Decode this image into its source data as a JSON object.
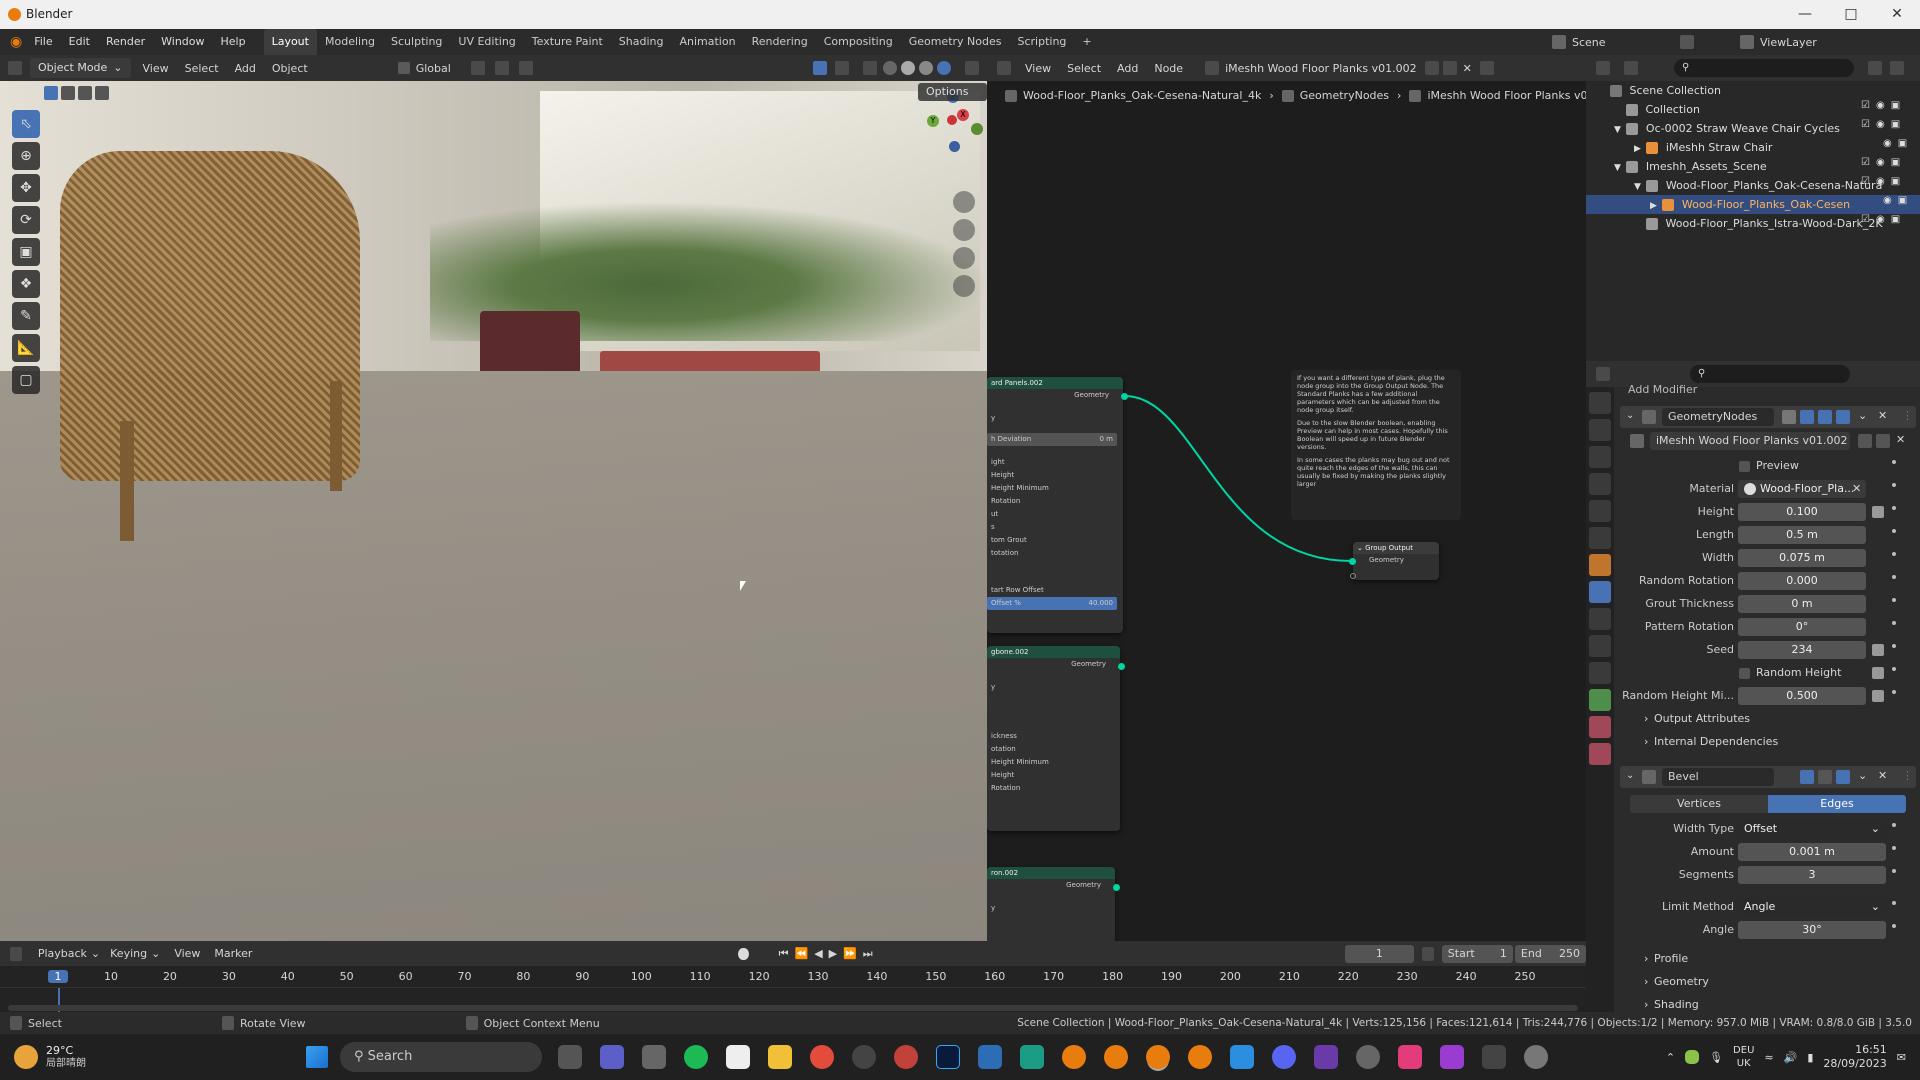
{
  "window": {
    "title": "Blender"
  },
  "menus": [
    "File",
    "Edit",
    "Render",
    "Window",
    "Help"
  ],
  "workspaces": [
    {
      "label": "Layout",
      "active": true
    },
    {
      "label": "Modeling"
    },
    {
      "label": "Sculpting"
    },
    {
      "label": "UV Editing"
    },
    {
      "label": "Texture Paint"
    },
    {
      "label": "Shading"
    },
    {
      "label": "Animation"
    },
    {
      "label": "Rendering"
    },
    {
      "label": "Compositing"
    },
    {
      "label": "Geometry Nodes"
    },
    {
      "label": "Scripting"
    }
  ],
  "scene": {
    "label": "Scene",
    "view_layer": "ViewLayer"
  },
  "viewport": {
    "mode": "Object Mode",
    "menus": [
      "View",
      "Select",
      "Add",
      "Object"
    ],
    "transform": "Global",
    "options": "Options",
    "gizmo": {
      "x": "X",
      "y": "Y",
      "z": "Z"
    }
  },
  "node_editor": {
    "menus": [
      "View",
      "Select",
      "Add",
      "Node"
    ],
    "tree_name": "iMeshh Wood Floor Planks v01.002",
    "breadcrumb": [
      "Wood-Floor_Planks_Oak-Cesena-Natural_4k",
      "GeometryNodes",
      "iMeshh Wood Floor Planks v01.002"
    ],
    "note": {
      "p1": "If you want a different type of plank, plug the node group into the Group Output Node. The Standard Planks has a few additional parameters which can be adjusted from the node group itself.",
      "p2": "Due to the slow Blender boolean, enabling Preview can help in most cases. Hopefully this Boolean will speed up in future Blender versions.",
      "p3": "In some cases the planks may bug out and not quite reach the edges of the walls, this can usually be fixed by making the planks slightly larger"
    },
    "nodes": [
      {
        "title": "ard Panels.002",
        "output": "Geometry",
        "rows": [
          "y",
          "h Deviation",
          "ight",
          "Height",
          "Height Minimum",
          "Rotation",
          "ut",
          "s",
          "tom Grout",
          "totation",
          "tart Row Offset",
          "Offset %"
        ],
        "dev_val": "0 m",
        "offset_val": "40.000"
      },
      {
        "title": "gbone.002",
        "output": "Geometry",
        "rows": [
          "y",
          "ickness",
          "otation",
          "Height Minimum",
          "Height",
          "Rotation"
        ]
      },
      {
        "title": "ron.002",
        "output": "Geometry",
        "rows": [
          "y"
        ]
      }
    ],
    "group_output": {
      "title": "Group Output",
      "input": "Geometry"
    }
  },
  "outliner": {
    "rows": [
      {
        "label": "Scene Collection",
        "indent": 0
      },
      {
        "label": "Collection",
        "indent": 1
      },
      {
        "label": "Oc-0002 Straw Weave Chair Cycles",
        "indent": 1
      },
      {
        "label": "iMeshh Straw Chair",
        "indent": 2
      },
      {
        "label": "Imeshh_Assets_Scene",
        "indent": 1
      },
      {
        "label": "Wood-Floor_Planks_Oak-Cesena-Natura",
        "indent": 2
      },
      {
        "label": "Wood-Floor_Planks_Oak-Cesen",
        "indent": 3,
        "selected": true
      },
      {
        "label": "Wood-Floor_Planks_Istra-Wood-Dark_2K",
        "indent": 2
      }
    ]
  },
  "properties": {
    "add_modifier": "Add Modifier",
    "gn_modifier": {
      "name": "GeometryNodes",
      "tree": "iMeshh Wood Floor Planks v01.002"
    },
    "fields": [
      {
        "label": "Preview",
        "type": "check"
      },
      {
        "label": "Material",
        "value": "Wood-Floor_Pla...",
        "type": "material"
      },
      {
        "label": "Height",
        "value": "0.100"
      },
      {
        "label": "Length",
        "value": "0.5 m"
      },
      {
        "label": "Width",
        "value": "0.075 m"
      },
      {
        "label": "Random Rotation",
        "value": "0.000"
      },
      {
        "label": "Grout Thickness",
        "value": "0 m"
      },
      {
        "label": "Pattern Rotation",
        "value": "0°"
      },
      {
        "label": "Seed",
        "value": "234"
      },
      {
        "label": "Random Height",
        "type": "check"
      },
      {
        "label": "Random Height Mi...",
        "value": "0.500"
      }
    ],
    "panels": [
      "Output Attributes",
      "Internal Dependencies"
    ],
    "bevel": {
      "name": "Bevel",
      "tabs": [
        "Vertices",
        "Edges"
      ],
      "width_type": {
        "label": "Width Type",
        "value": "Offset"
      },
      "amount": {
        "label": "Amount",
        "value": "0.001 m"
      },
      "segments": {
        "label": "Segments",
        "value": "3"
      },
      "limit_method": {
        "label": "Limit Method",
        "value": "Angle"
      },
      "angle": {
        "label": "Angle",
        "value": "30°"
      },
      "subpanels": [
        "Profile",
        "Geometry",
        "Shading"
      ]
    }
  },
  "timeline": {
    "menus": [
      "Playback",
      "Keying",
      "View",
      "Marker"
    ],
    "current_frame": "1",
    "start_label": "Start",
    "start": "1",
    "end_label": "End",
    "end": "250",
    "ticks": [
      "1",
      "10",
      "20",
      "30",
      "40",
      "50",
      "60",
      "70",
      "80",
      "90",
      "100",
      "110",
      "120",
      "130",
      "140",
      "150",
      "160",
      "170",
      "180",
      "190",
      "200",
      "210",
      "220",
      "230",
      "240",
      "250"
    ]
  },
  "statusbar": {
    "left": [
      {
        "label": "Select"
      },
      {
        "label": "Rotate View"
      },
      {
        "label": "Object Context Menu"
      }
    ],
    "right": "Scene Collection | Wood-Floor_Planks_Oak-Cesena-Natural_4k | Verts:125,156 | Faces:121,614 | Tris:244,776 | Objects:1/2 | Memory: 957.0 MiB | VRAM: 0.8/8.0 GiB | 3.5.0"
  },
  "taskbar": {
    "weather_temp": "29°C",
    "weather_desc": "局部晴朗",
    "search": "Search",
    "lang1": "DEU",
    "lang2": "UK",
    "time": "16:51",
    "date": "28/09/2023"
  }
}
